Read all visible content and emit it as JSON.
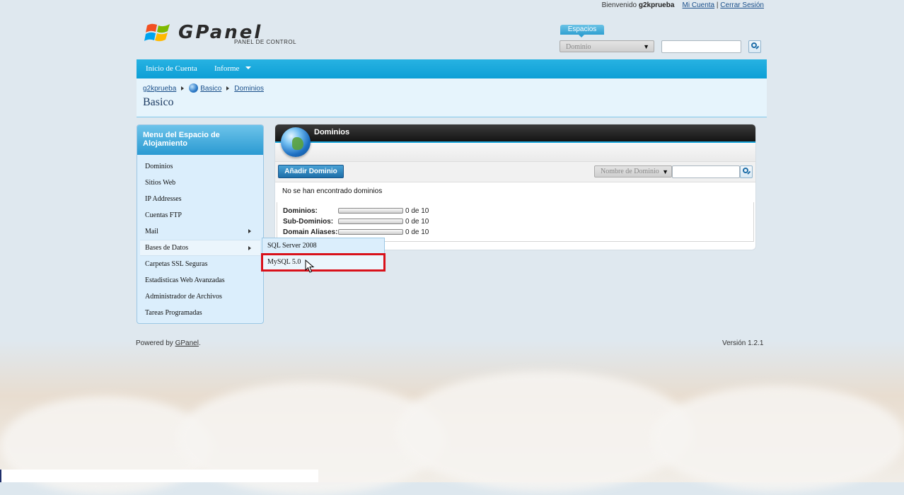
{
  "header": {
    "logo_word": "GPanel",
    "logo_sub": "PANEL DE CONTROL",
    "welcome": "Bienvenido",
    "username": "g2kprueba",
    "my_account": "Mi Cuenta",
    "separator": "|",
    "logout": "Cerrar Sesión",
    "spaces_tab": "Espacios",
    "domain_select": "Dominio",
    "search_value": ""
  },
  "nav": {
    "items": [
      {
        "label": "Inicio de Cuenta"
      },
      {
        "label": "Informe"
      }
    ]
  },
  "breadcrumb": {
    "items": [
      {
        "label": "g2kprueba"
      },
      {
        "label": "Basico"
      },
      {
        "label": "Dominios"
      }
    ],
    "page_title": "Basico"
  },
  "left_menu": {
    "title": "Menu del Espacio de Alojamiento",
    "items": [
      {
        "label": "Dominios"
      },
      {
        "label": "Sitios Web"
      },
      {
        "label": "IP Addresses"
      },
      {
        "label": "Cuentas FTP"
      },
      {
        "label": "Mail"
      },
      {
        "label": "Bases de Datos"
      },
      {
        "label": "Carpetas SSL Seguras"
      },
      {
        "label": "Estadisticas Web Avanzadas"
      },
      {
        "label": "Administrador de Archivos"
      },
      {
        "label": "Tareas Programadas"
      }
    ]
  },
  "submenu": {
    "items": [
      {
        "label": "SQL Server 2008"
      },
      {
        "label": "MySQL 5.0"
      }
    ]
  },
  "panel": {
    "title": "Dominios",
    "add_button": "Añadir Dominio",
    "filter_select": "Nombre de Dominio",
    "search_value": "",
    "empty_message": "No se han encontrado dominios",
    "quotas": [
      {
        "label": "Dominios:",
        "value": "0 de 10",
        "used": 0,
        "max": 10
      },
      {
        "label": "Sub-Dominios:",
        "value": "0 de 10",
        "used": 0,
        "max": 10
      },
      {
        "label": "Domain Aliases:",
        "value": "0 de 10",
        "used": 0,
        "max": 10
      }
    ]
  },
  "footer": {
    "powered_by": "Powered by",
    "brand_link": "GPanel",
    "period": ".",
    "version": "Versión 1.2.1"
  },
  "colors": {
    "accent": "#0d9fd6",
    "highlight": "#d9111a",
    "link": "#1a4f8a"
  }
}
